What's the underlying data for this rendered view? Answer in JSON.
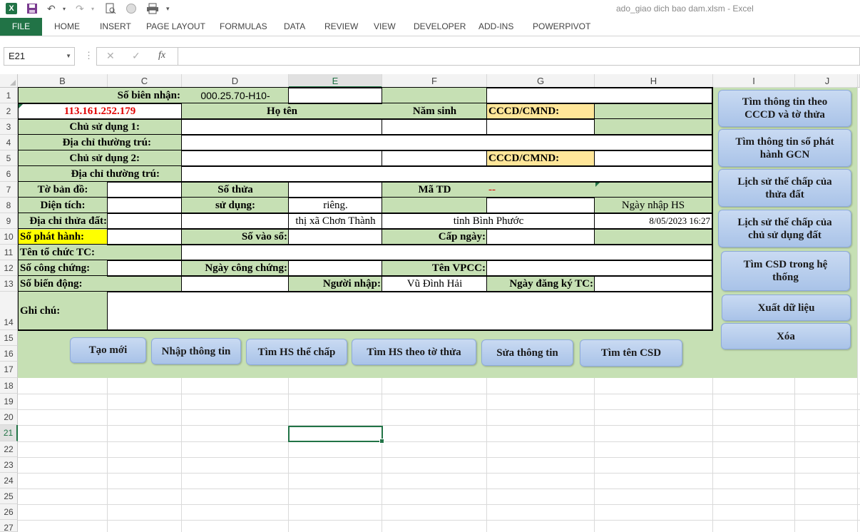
{
  "window": {
    "title": "ado_giao dich bao dam.xlsm - Excel"
  },
  "ribbon": {
    "tabs": [
      "FILE",
      "HOME",
      "INSERT",
      "PAGE LAYOUT",
      "FORMULAS",
      "DATA",
      "REVIEW",
      "VIEW",
      "DEVELOPER",
      "ADD-INS",
      "POWERPIVOT"
    ]
  },
  "formula_bar": {
    "name_box": "E21",
    "fx": "fx",
    "formula": ""
  },
  "columns": [
    "B",
    "C",
    "D",
    "E",
    "F",
    "G",
    "H",
    "I",
    "J"
  ],
  "rows": [
    "1",
    "2",
    "3",
    "4",
    "5",
    "6",
    "7",
    "8",
    "9",
    "10",
    "11",
    "12",
    "13",
    "14",
    "15",
    "16",
    "17",
    "18",
    "19",
    "20",
    "21",
    "22",
    "23",
    "24",
    "25",
    "26",
    "27"
  ],
  "form": {
    "so_bien_nhan_label": "Số biên nhận:",
    "so_bien_nhan_value": "000.25.70-H10-",
    "ip": "113.161.252.179",
    "ho_ten": "Họ tên",
    "nam_sinh": "Năm sinh",
    "cccd_1": "CCCD/CMND:",
    "chu_su_dung_1": "Chủ sử dụng 1:",
    "dia_chi_1": "Địa chỉ thường trú:",
    "chu_su_dung_2": "Chủ sử dụng 2:",
    "cccd_2": "CCCD/CMND:",
    "dia_chi_2": "Địa chỉ thường trú:",
    "to_ban_do": "Tờ bản đồ:",
    "so_thua": "Số thửa",
    "ma_td": "Mã TD",
    "ma_td_value": "--",
    "dien_tich": "Diện tích:",
    "su_dung": "sử dụng:",
    "rieng": "riêng.",
    "ngay_nhap_hs": "Ngày nhập HS",
    "dia_chi_thua_dat": "Địa chỉ thửa đất:",
    "thi_xa": "thị xã Chơn Thành",
    "tinh": "tỉnh Bình Phước",
    "ngay_nhap_value": "8/05/2023 16:27",
    "so_phat_hanh": "Số phát hành:",
    "so_vao_so": "Số vào sổ:",
    "cap_ngay": "Cấp ngày:",
    "ten_to_chuc": "Tên tổ chức TC:",
    "so_cong_chung": "Số công chứng:",
    "ngay_cong_chung": "Ngày công chứng:",
    "ten_vpcc": "Tên VPCC:",
    "so_bien_dong": "Số biến động:",
    "nguoi_nhap": "Người nhập:",
    "nguoi_nhap_value": "Vũ Đình Hải",
    "ngay_dang_ky": "Ngày đăng ký TC:",
    "ghi_chu": "Ghi chú:"
  },
  "bottom_buttons": [
    "Tạo mới",
    "Nhập thông tin",
    "Tìm HS thế chấp",
    "Tìm HS theo tờ thửa",
    "Sửa thông tin",
    "Tìm tên CSD"
  ],
  "side_buttons": [
    "Tìm thông tin theo CCCD và tờ thửa",
    "Tìm thông tin số phát hành GCN",
    "Lịch sử thế chấp của thửa đất",
    "Lịch sử thế chấp của chủ sử dụng đất",
    "Tìm CSD trong hệ thống",
    "Xuất dữ liệu",
    "Xóa"
  ],
  "colors": {
    "accent": "#217346",
    "form_green": "#c6e0b4",
    "button_blue": "#b4c7e7",
    "ip_red": "#e00000",
    "peach": "#ffe699",
    "yellow": "#ffff00"
  }
}
